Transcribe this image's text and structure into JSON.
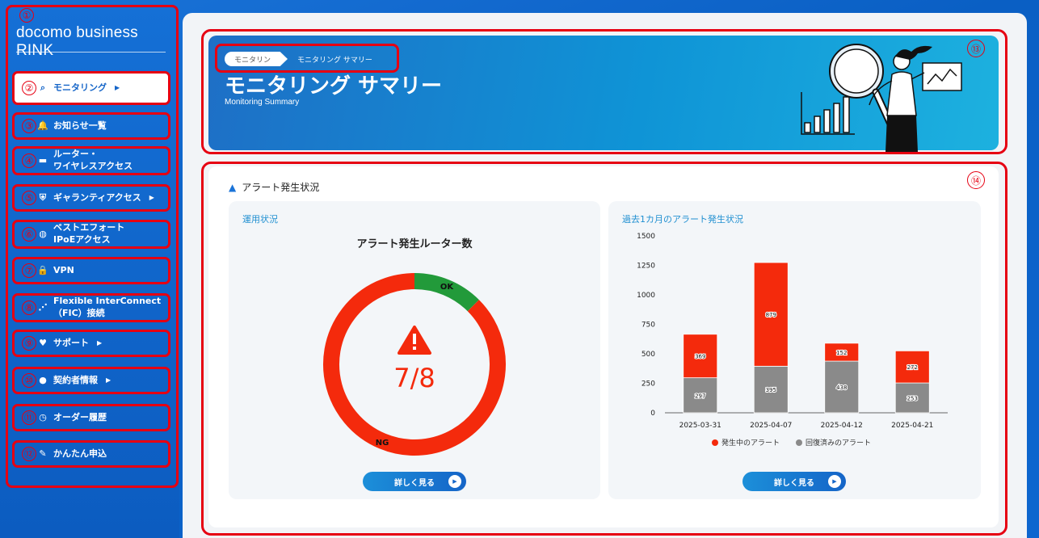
{
  "sidebar": {
    "brand": "docomo business RINK",
    "markers": [
      "①"
    ],
    "items": [
      {
        "num": "②",
        "label": "モニタリング",
        "icon": "monitor-search-icon",
        "arrow": "▶"
      },
      {
        "num": "③",
        "label": "お知らせ一覧",
        "icon": "bell-icon",
        "arrow": ""
      },
      {
        "num": "④",
        "label": "ルーター・\nワイヤレスアクセス",
        "icon": "router-icon",
        "arrow": ""
      },
      {
        "num": "⑤",
        "label": "ギャランティアクセス",
        "icon": "shield-icon",
        "arrow": "▶"
      },
      {
        "num": "⑥",
        "label": "ベストエフォート\nIPoEアクセス",
        "icon": "globe-icon",
        "arrow": ""
      },
      {
        "num": "⑦",
        "label": "VPN",
        "icon": "lock-icon",
        "arrow": ""
      },
      {
        "num": "⑧",
        "label": "Flexible InterConnect\n（FIC）接続",
        "icon": "network-icon",
        "arrow": ""
      },
      {
        "num": "⑨",
        "label": "サポート",
        "icon": "support-icon",
        "arrow": "▶"
      },
      {
        "num": "⑩",
        "label": "契約者情報",
        "icon": "user-icon",
        "arrow": "▶"
      },
      {
        "num": "⑪",
        "label": "オーダー履歴",
        "icon": "clock-icon",
        "arrow": ""
      },
      {
        "num": "⑫",
        "label": "かんたん申込",
        "icon": "edit-icon",
        "arrow": ""
      }
    ]
  },
  "hero": {
    "breadcrumb": [
      "モニタリング",
      "モニタリング サマリー"
    ],
    "title": "モニタリング サマリー",
    "subtitle": "Monitoring Summary",
    "marker": "⑬"
  },
  "section": {
    "title": "アラート発生状況",
    "marker": "⑭",
    "left_panel": {
      "title": "運用状況",
      "chart_heading": "アラート発生ルーター数",
      "center_value": "7/8",
      "button": "詳しく見る"
    },
    "right_panel": {
      "title": "過去1カ月のアラート発生状況",
      "button": "詳しく見る"
    }
  },
  "colors": {
    "ng": "#f42a0c",
    "ok": "#229a3a",
    "recovered": "#8a8a8a",
    "accent": "#1565c8",
    "marker_red": "#e60012"
  },
  "chart_data": [
    {
      "type": "pie",
      "labels": [
        "OK",
        "NG"
      ],
      "values": [
        1,
        7
      ],
      "center_text": "7/8",
      "title": "アラート発生ルーター数"
    },
    {
      "type": "bar",
      "stacked": true,
      "categories": [
        "2025-03-31",
        "2025-04-07",
        "2025-04-12",
        "2025-04-21"
      ],
      "series": [
        {
          "name": "回復済みのアラート",
          "values": [
            297,
            395,
            438,
            253
          ]
        },
        {
          "name": "発生中のアラート",
          "values": [
            369,
            879,
            152,
            272
          ]
        }
      ],
      "ylim": [
        0,
        1500
      ],
      "yticks": [
        0,
        250,
        500,
        750,
        1000,
        1250,
        1500
      ],
      "legend": "bottom"
    }
  ]
}
